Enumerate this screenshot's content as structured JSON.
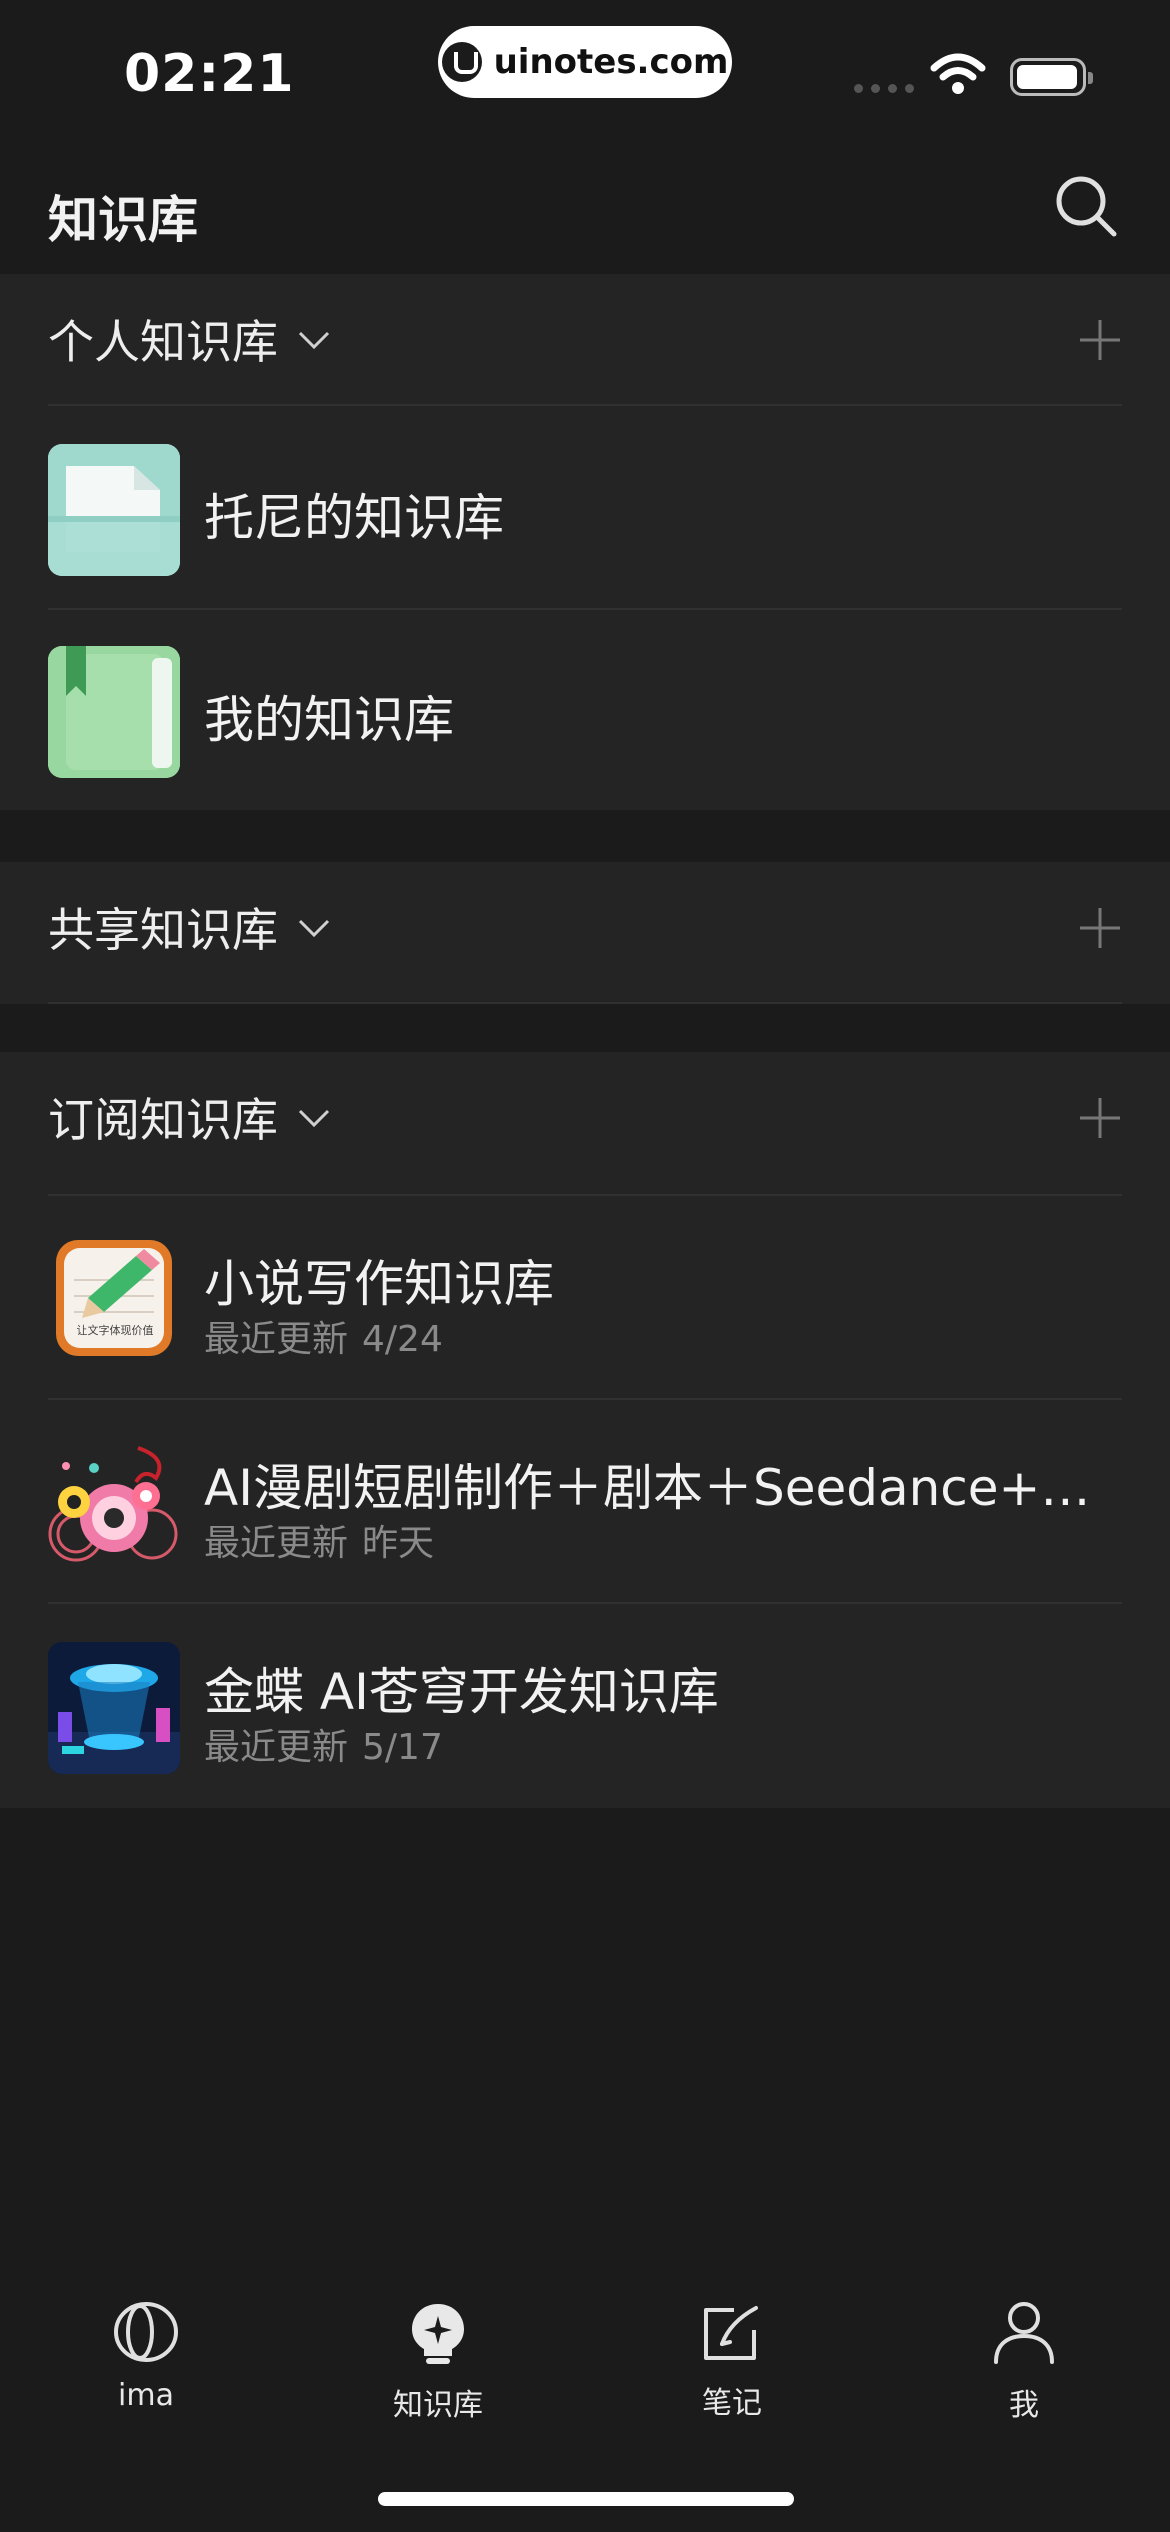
{
  "status": {
    "time": "02:21",
    "domain": "uinotes.com"
  },
  "header": {
    "title": "知识库",
    "search_icon": "search-icon"
  },
  "sections": [
    {
      "label": "个人知识库",
      "items": [
        {
          "name": "托尼的知识库",
          "icon": "folder-document-icon"
        },
        {
          "name": "我的知识库",
          "icon": "green-book-icon"
        }
      ]
    },
    {
      "label": "共享知识库",
      "items": []
    },
    {
      "label": "订阅知识库",
      "items": [
        {
          "name": "小说写作知识库",
          "sub_prefix": "最近更新",
          "sub_value": "4/24",
          "icon": "notebook-pencil-icon",
          "badge_text": "让文字体现价值"
        },
        {
          "name": "AI漫剧短剧制作＋剧本＋Seedance+…",
          "sub_prefix": "最近更新",
          "sub_value": "昨天",
          "icon": "colorful-illustration-icon"
        },
        {
          "name": "金蝶 AI苍穹开发知识库",
          "sub_prefix": "最近更新",
          "sub_value": "5/17",
          "icon": "futuristic-tech-icon"
        }
      ]
    }
  ],
  "tabs": [
    {
      "label": "ima",
      "icon": "ima-logo-icon"
    },
    {
      "label": "知识库",
      "icon": "knowledge-bulb-icon",
      "active": true
    },
    {
      "label": "笔记",
      "icon": "note-pen-icon"
    },
    {
      "label": "我",
      "icon": "person-icon"
    }
  ],
  "colors": {
    "background": "#1b1b1b",
    "section": "#242424",
    "subtext": "#8a8a8a"
  }
}
